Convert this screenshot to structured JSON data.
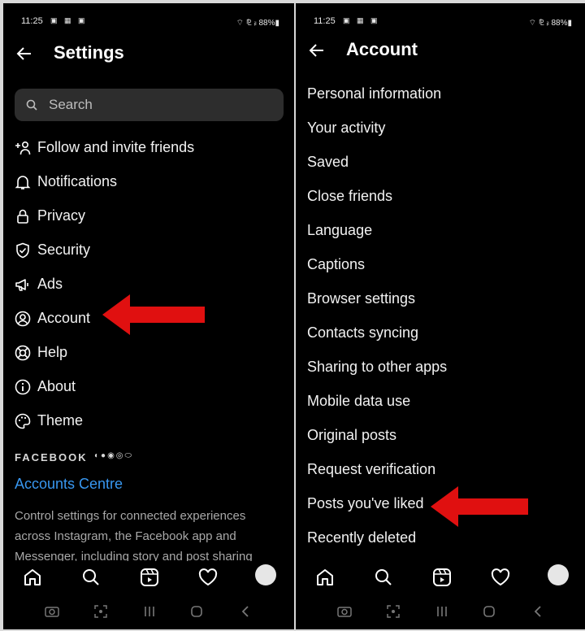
{
  "status": {
    "time": "11:25",
    "icons": "▣ ▦ ▣",
    "right": "⌔ ⅊ ᵢₗ 88%▮"
  },
  "left": {
    "title": "Settings",
    "search_placeholder": "Search",
    "menu": [
      {
        "label": "Follow and invite friends",
        "icon": "add-person-icon"
      },
      {
        "label": "Notifications",
        "icon": "bell-icon"
      },
      {
        "label": "Privacy",
        "icon": "lock-icon"
      },
      {
        "label": "Security",
        "icon": "shield-icon"
      },
      {
        "label": "Ads",
        "icon": "megaphone-icon"
      },
      {
        "label": "Account",
        "icon": "account-circle-icon"
      },
      {
        "label": "Help",
        "icon": "lifebuoy-icon"
      },
      {
        "label": "About",
        "icon": "info-icon"
      },
      {
        "label": "Theme",
        "icon": "palette-icon"
      }
    ],
    "facebook_header": "FACEBOOK",
    "facebook_icons": "◐●◉◎⬭",
    "accounts_centre": "Accounts Centre",
    "description": "Control settings for connected experiences across Instagram, the Facebook app and Messenger, including story and post sharing"
  },
  "right": {
    "title": "Account",
    "items": [
      "Personal information",
      "Your activity",
      "Saved",
      "Close friends",
      "Language",
      "Captions",
      "Browser settings",
      "Contacts syncing",
      "Sharing to other apps",
      "Mobile data use",
      "Original posts",
      "Request verification",
      "Posts you've liked",
      "Recently deleted"
    ]
  },
  "tabbar": [
    "home-icon",
    "search-icon",
    "reels-icon",
    "heart-icon",
    "profile-avatar"
  ],
  "colors": {
    "background": "#000000",
    "link": "#3897f0",
    "arrow": "#e01010",
    "search_bg": "#2d2d2d"
  }
}
